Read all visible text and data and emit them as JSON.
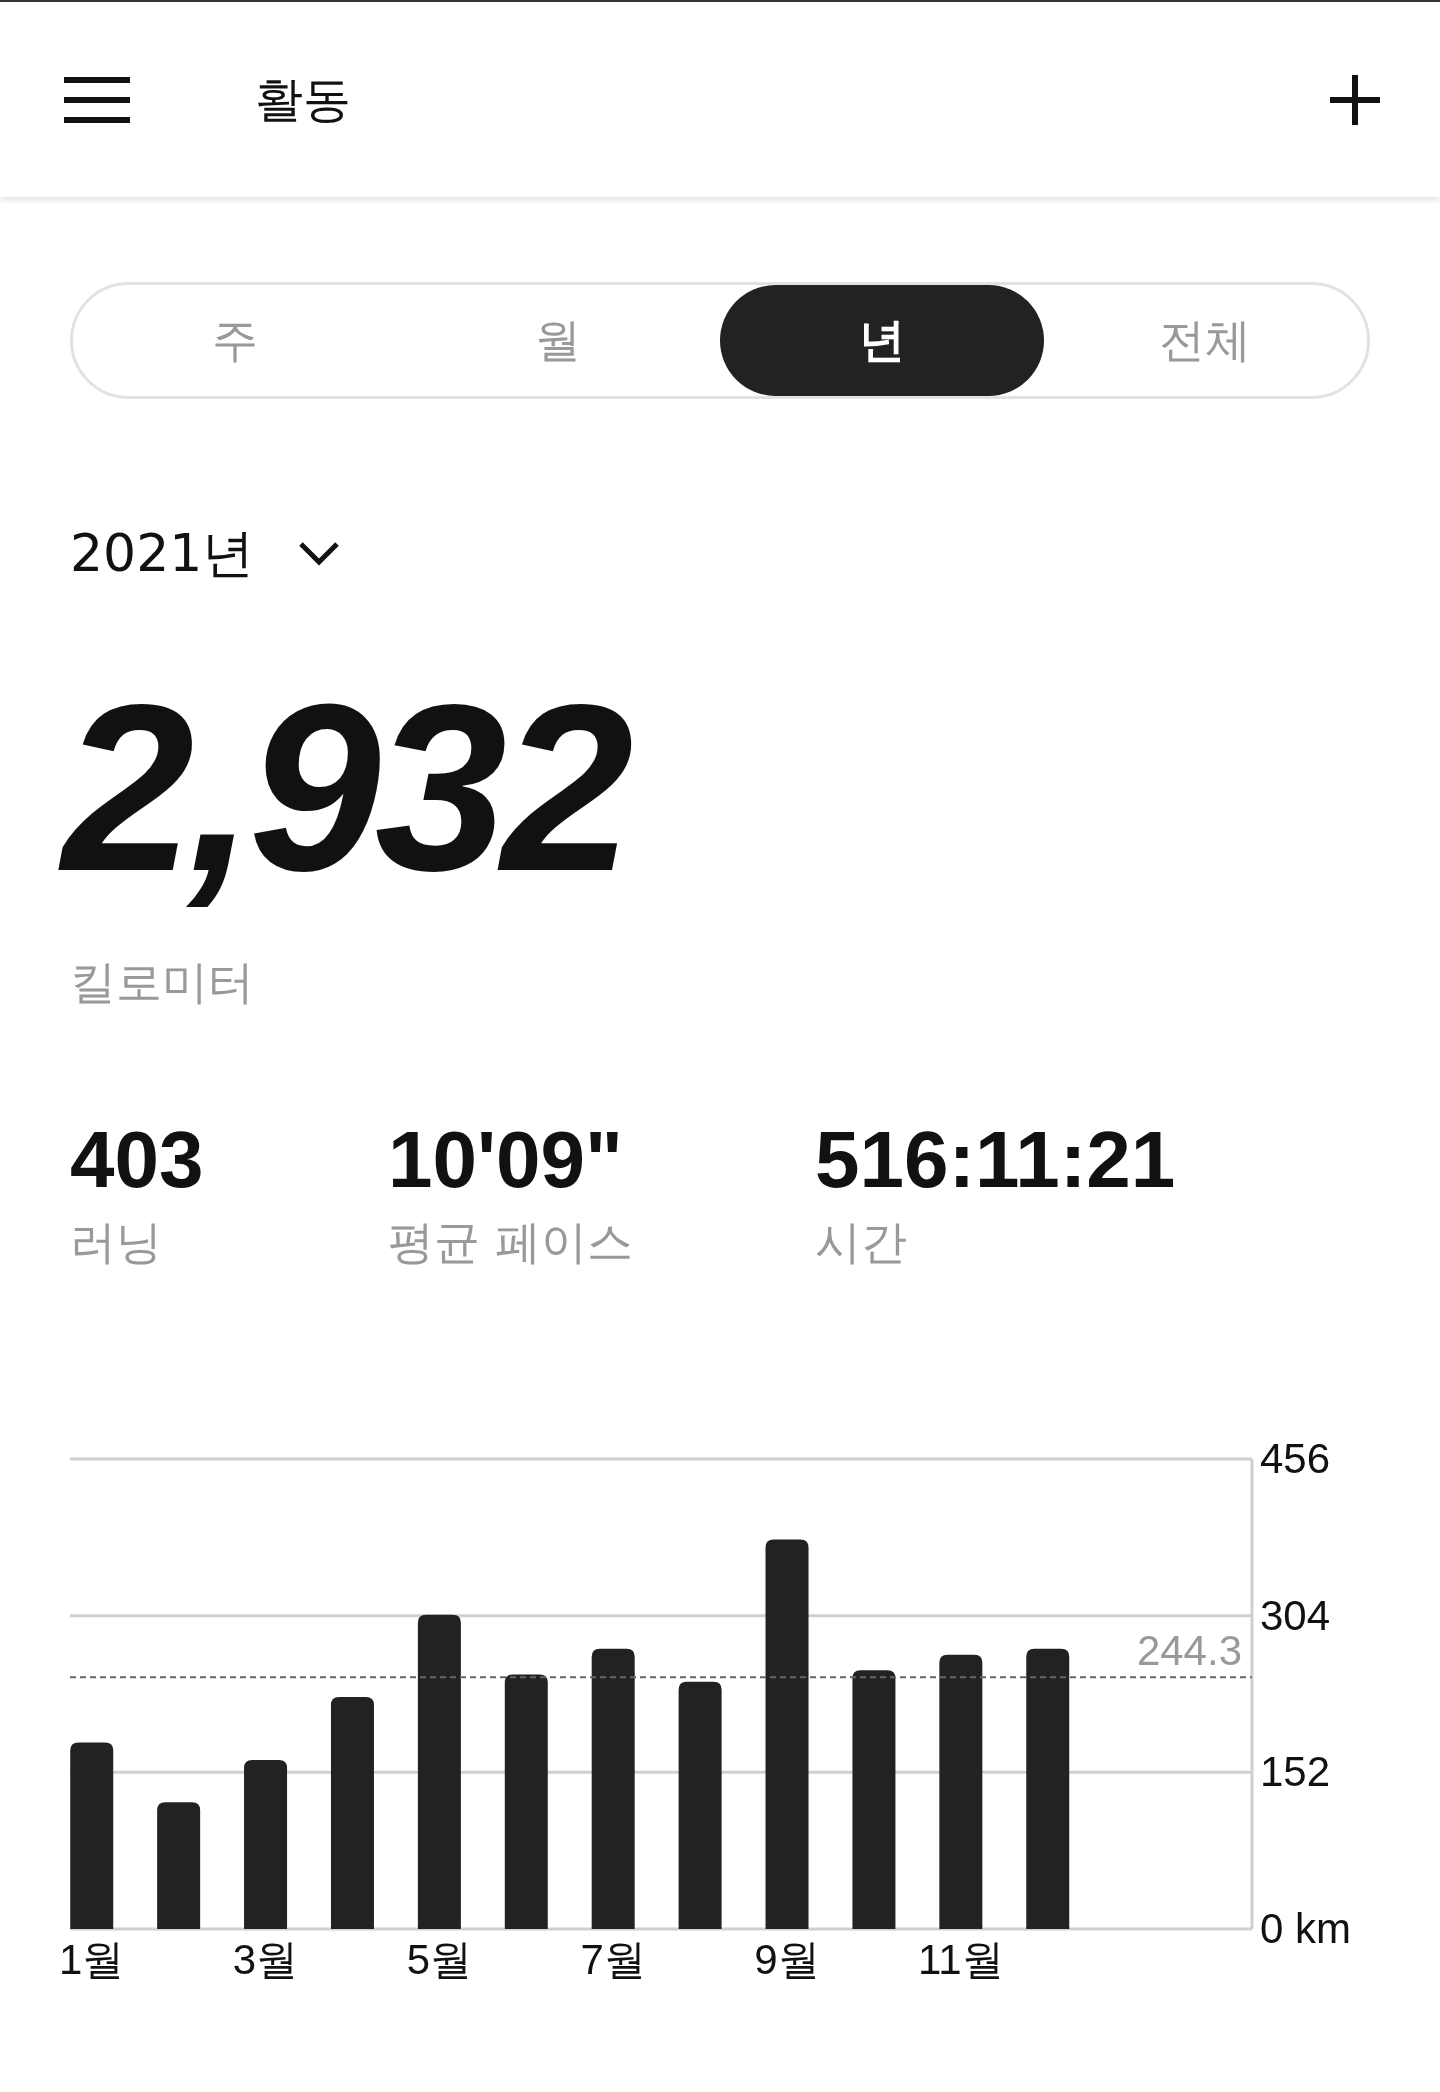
{
  "header": {
    "title": "활동"
  },
  "tabs": [
    {
      "label": "주",
      "selected": false
    },
    {
      "label": "월",
      "selected": false
    },
    {
      "label": "년",
      "selected": true
    },
    {
      "label": "전체",
      "selected": false
    }
  ],
  "period": {
    "label": "2021년"
  },
  "total": {
    "value": "2,932",
    "unit": "킬로미터"
  },
  "stats": [
    {
      "value": "403",
      "label": "러닝"
    },
    {
      "value": "10'09\"",
      "label": "평균 페이스"
    },
    {
      "value": "516:11:21",
      "label": "시간"
    }
  ],
  "chart": {
    "chart_data": {
      "type": "bar",
      "values": [
        181,
        123,
        164,
        225,
        305,
        247,
        272,
        240,
        378,
        251,
        266,
        272
      ],
      "ylim": [
        0,
        456
      ],
      "yticks": [
        {
          "value": 0,
          "label": "0 km"
        },
        {
          "value": 152,
          "label": "152"
        },
        {
          "value": 304,
          "label": "304"
        },
        {
          "value": 456,
          "label": "456"
        }
      ],
      "xlim": [
        0.75,
        14.35
      ],
      "x": [
        1,
        2,
        3,
        4,
        5,
        6,
        7,
        8,
        9,
        10,
        11,
        12
      ],
      "xticks": [
        {
          "value": 1,
          "label": "1월"
        },
        {
          "value": 3,
          "label": "3월"
        },
        {
          "value": 5,
          "label": "5월"
        },
        {
          "value": 7,
          "label": "7월"
        },
        {
          "value": 9,
          "label": "9월"
        },
        {
          "value": 11,
          "label": "11월"
        }
      ],
      "ref_lines": [
        {
          "axis": "y",
          "value": 244.3,
          "label": "244.3"
        }
      ]
    }
  }
}
